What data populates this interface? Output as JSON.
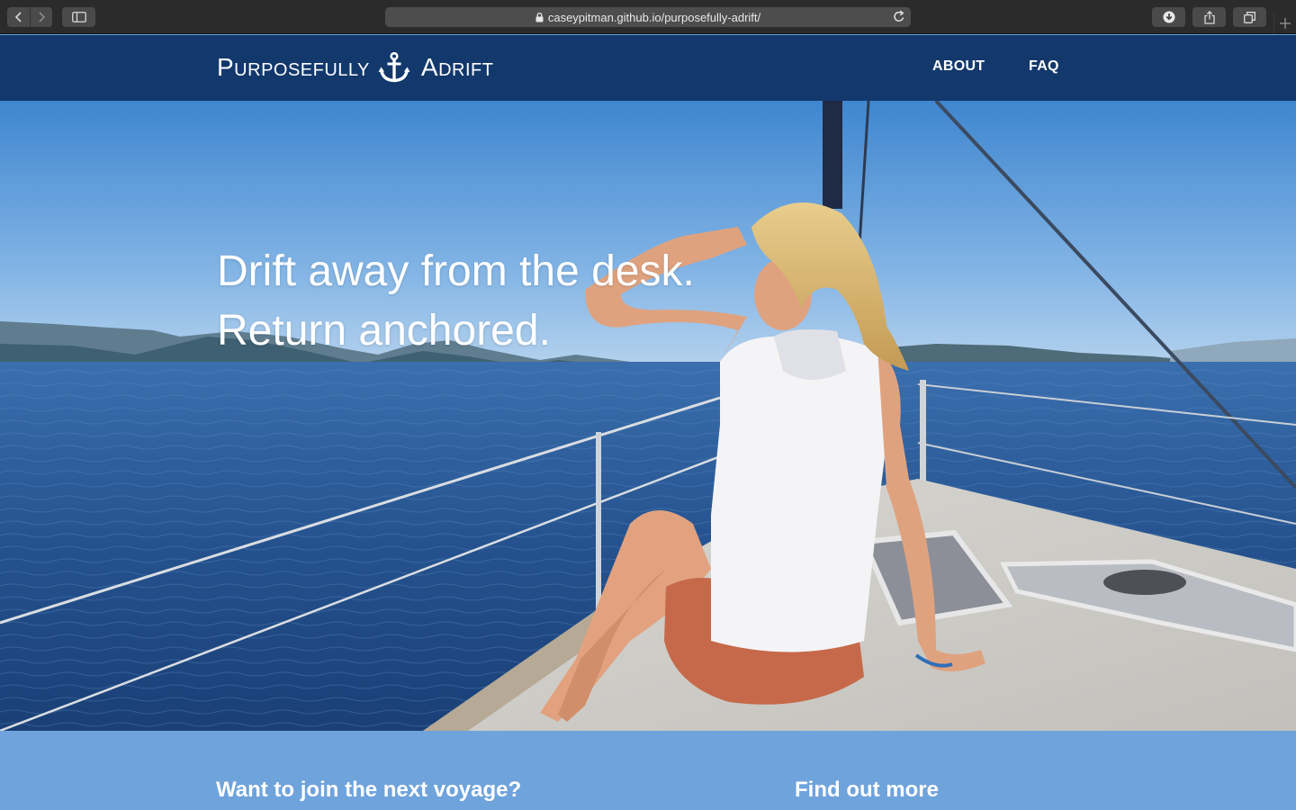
{
  "browser": {
    "url": "caseypitman.github.io/purposefully-adrift/",
    "icons": [
      "back-icon",
      "forward-icon",
      "sidebar-icon",
      "lock-icon",
      "reload-icon",
      "download-icon",
      "share-icon",
      "tabs-icon",
      "plus-icon"
    ]
  },
  "header": {
    "brand_left": "Purposefully",
    "brand_right": "Adrift",
    "brand_icon": "anchor-icon",
    "nav": [
      {
        "label": "ABOUT"
      },
      {
        "label": "FAQ"
      }
    ]
  },
  "hero": {
    "line1": "Drift away from the desk.",
    "line2": "Return anchored.",
    "image": "woman-on-sailboat-bow"
  },
  "band": {
    "left": "Want to join the next voyage?",
    "right": "Find out more"
  },
  "colors": {
    "header_bg": "#13386c",
    "band_bg": "#6fa3dc",
    "chrome_bg": "#2b2b2b"
  }
}
